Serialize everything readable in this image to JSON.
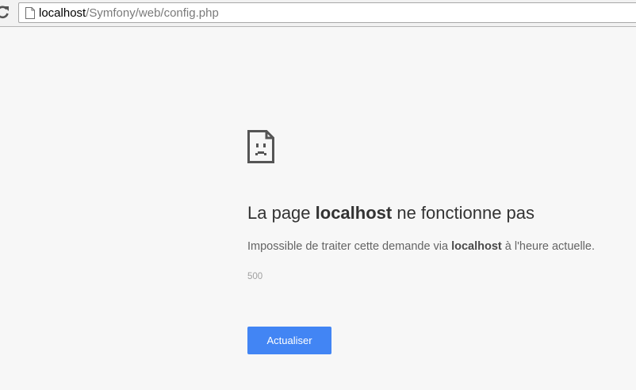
{
  "browser": {
    "url_host": "localhost",
    "url_path": "/Symfony/web/config.php"
  },
  "error": {
    "icon": "sad-page-icon",
    "title_prefix": "La page ",
    "title_host": "localhost",
    "title_suffix": " ne fonctionne pas",
    "desc_prefix": "Impossible de traiter cette demande via ",
    "desc_host": "localhost",
    "desc_suffix": " à l'heure actuelle.",
    "code": "500",
    "button_label": "Actualiser"
  },
  "colors": {
    "page_background": "#f7f7f7",
    "button": "#4285f4",
    "title_text": "#333333"
  }
}
